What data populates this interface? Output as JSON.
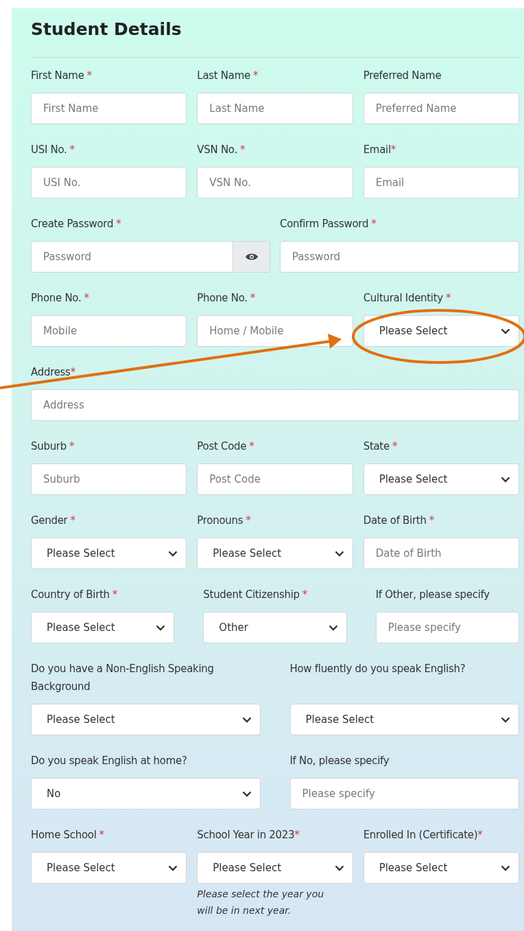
{
  "title": "Student Details",
  "rows": [
    {
      "kind": "standard",
      "fields": [
        {
          "label": "First Name",
          "asterisk": "*",
          "kind": "text",
          "placeholder": "First Name"
        },
        {
          "label": "Last Name",
          "asterisk": "*",
          "kind": "text",
          "placeholder": "Last Name"
        },
        {
          "label": "Preferred Name",
          "kind": "text",
          "placeholder": "Preferred Name"
        }
      ]
    },
    {
      "kind": "standard",
      "fields": [
        {
          "label": "USI No.",
          "asterisk": "*",
          "kind": "text",
          "placeholder": "USI No."
        },
        {
          "label": "VSN No.",
          "asterisk": "*",
          "kind": "text",
          "placeholder": "VSN No."
        },
        {
          "label": "Email",
          "asterisk": "*",
          "tight": true,
          "kind": "text",
          "placeholder": "Email"
        }
      ]
    },
    {
      "kind": "standard",
      "fields": [
        {
          "label": "Create Password",
          "asterisk": "*",
          "kind": "password-toggle",
          "placeholder": "Password"
        },
        {
          "label": "Confirm Password",
          "asterisk": "*",
          "kind": "text",
          "placeholder": "Password"
        }
      ]
    },
    {
      "kind": "standard",
      "fields": [
        {
          "label": "Phone No.",
          "asterisk": "*",
          "kind": "text",
          "placeholder": "Mobile"
        },
        {
          "label": "Phone No.",
          "asterisk": "*",
          "kind": "text",
          "placeholder": "Home / Mobile"
        },
        {
          "label": "Cultural Identity",
          "asterisk": "*",
          "kind": "select",
          "value": "Please Select"
        }
      ]
    },
    {
      "kind": "standard",
      "fields": [
        {
          "label": "Address",
          "asterisk": "*",
          "tight": true,
          "kind": "text",
          "placeholder": "Address"
        }
      ]
    },
    {
      "kind": "standard",
      "fields": [
        {
          "label": "Suburb",
          "asterisk": "*",
          "kind": "text",
          "placeholder": "Suburb"
        },
        {
          "label": "Post Code",
          "asterisk": "*",
          "kind": "text",
          "placeholder": "Post Code"
        },
        {
          "label": "State",
          "asterisk": "*",
          "kind": "select",
          "value": "Please Select"
        }
      ]
    },
    {
      "kind": "standard",
      "fields": [
        {
          "label": "Gender",
          "asterisk": "*",
          "kind": "select",
          "value": "Please Select"
        },
        {
          "label": "Pronouns",
          "asterisk": "*",
          "kind": "select",
          "value": "Please Select"
        },
        {
          "label": "Date of Birth",
          "asterisk": "*",
          "kind": "text",
          "placeholder": "Date of Birth"
        }
      ]
    },
    {
      "kind": "wide",
      "fields": [
        {
          "label": "Country of Birth",
          "asterisk": "*",
          "kind": "select",
          "value": "Please Select"
        },
        {
          "label": "Student Citizenship",
          "asterisk": "*",
          "kind": "select",
          "value": "Other"
        },
        {
          "label": "If Other, please specify",
          "kind": "text",
          "placeholder": "Please specify"
        }
      ]
    },
    {
      "kind": "wide",
      "fields": [
        {
          "label": "Do you have a Non-English Speaking Background",
          "kind": "select",
          "value": "Please Select"
        },
        {
          "label": "How fluently do you speak English?",
          "kind": "select",
          "value": "Please Select"
        }
      ]
    },
    {
      "kind": "wide",
      "fields": [
        {
          "label": "Do you speak English at home?",
          "kind": "select",
          "value": "No"
        },
        {
          "label": "If No, please specify",
          "kind": "text",
          "placeholder": "Please specify"
        }
      ]
    },
    {
      "kind": "standard",
      "fields": [
        {
          "label": "Home School",
          "asterisk": "*",
          "kind": "select",
          "value": "Please Select"
        },
        {
          "label": "School Year in 2023",
          "asterisk": "*",
          "tight": true,
          "kind": "select",
          "value": "Please Select",
          "help": "Please select the year you will be in next year."
        },
        {
          "label": "Enrolled In (Certificate)",
          "asterisk": "*",
          "tight": true,
          "kind": "select",
          "value": "Please Select"
        }
      ]
    }
  ]
}
